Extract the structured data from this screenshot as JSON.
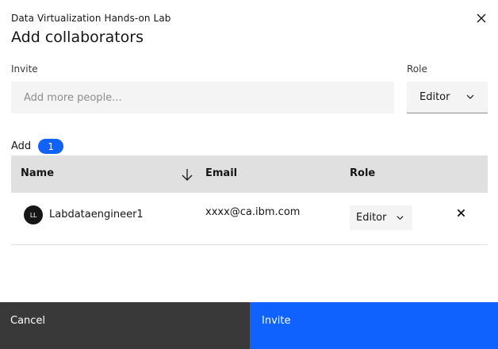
{
  "modal": {
    "subtitle": "Data Virtualization Hands-on Lab",
    "title": "Add collaborators"
  },
  "form": {
    "invite_label": "Invite",
    "invite_placeholder": "Add more people...",
    "role_label": "Role",
    "role_value": "Editor"
  },
  "add_section": {
    "label": "Add",
    "count": "1"
  },
  "table": {
    "columns": {
      "name": "Name",
      "email": "Email",
      "role": "Role"
    },
    "rows": [
      {
        "initials": "LL",
        "name": "Labdataengineer1",
        "email": "xxxx@ca.ibm.com",
        "role": "Editor"
      }
    ]
  },
  "footer": {
    "cancel_label": "Cancel",
    "invite_label": "Invite"
  },
  "colors": {
    "primary": "#0f62fe",
    "secondary": "#393939",
    "header_bg": "#e0e0e0",
    "field_bg": "#f4f4f4"
  },
  "icons": [
    "close-icon",
    "chevron-down-icon",
    "arrow-down-icon",
    "remove-icon"
  ]
}
